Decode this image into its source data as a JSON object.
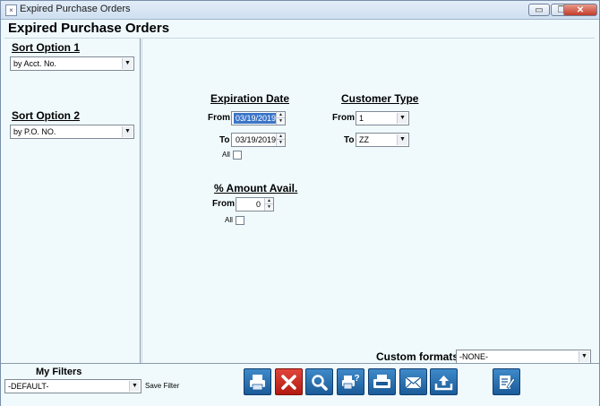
{
  "window": {
    "title": "Expired Purchase Orders",
    "controls": {
      "minimize": "▭",
      "restore": "❐",
      "close": "✕"
    }
  },
  "page_title": "Expired Purchase Orders",
  "sort1": {
    "label": "Sort Option 1",
    "value": "by Acct. No."
  },
  "sort2": {
    "label": "Sort Option 2",
    "value": "by P.O. NO."
  },
  "expiration": {
    "label": "Expiration Date",
    "from_label": "From",
    "from_value": "03/19/2019",
    "to_label": "To",
    "to_value": "03/19/2019",
    "all_label": "All"
  },
  "customer_type": {
    "label": "Customer Type",
    "from_label": "From",
    "from_value": "1",
    "to_label": "To",
    "to_value": "ZZ"
  },
  "amount": {
    "label": "% Amount Avail.",
    "from_label": "From",
    "from_value": "0",
    "all_label": "All"
  },
  "custom_formats": {
    "label": "Custom formats.",
    "value": "-NONE-"
  },
  "my_filters": {
    "label": "My Filters",
    "value": "-DEFAULT-",
    "save_label": "Save Filter"
  },
  "toolbar": {
    "icons": [
      "print-icon",
      "cancel-icon",
      "preview-icon",
      "print-setup-icon",
      "fax-icon",
      "email-icon",
      "export-icon",
      "edit-format-icon"
    ]
  },
  "colors": {
    "accent": "#2a6fb1",
    "cancel": "#c8281d",
    "background": "#f0fafd"
  }
}
